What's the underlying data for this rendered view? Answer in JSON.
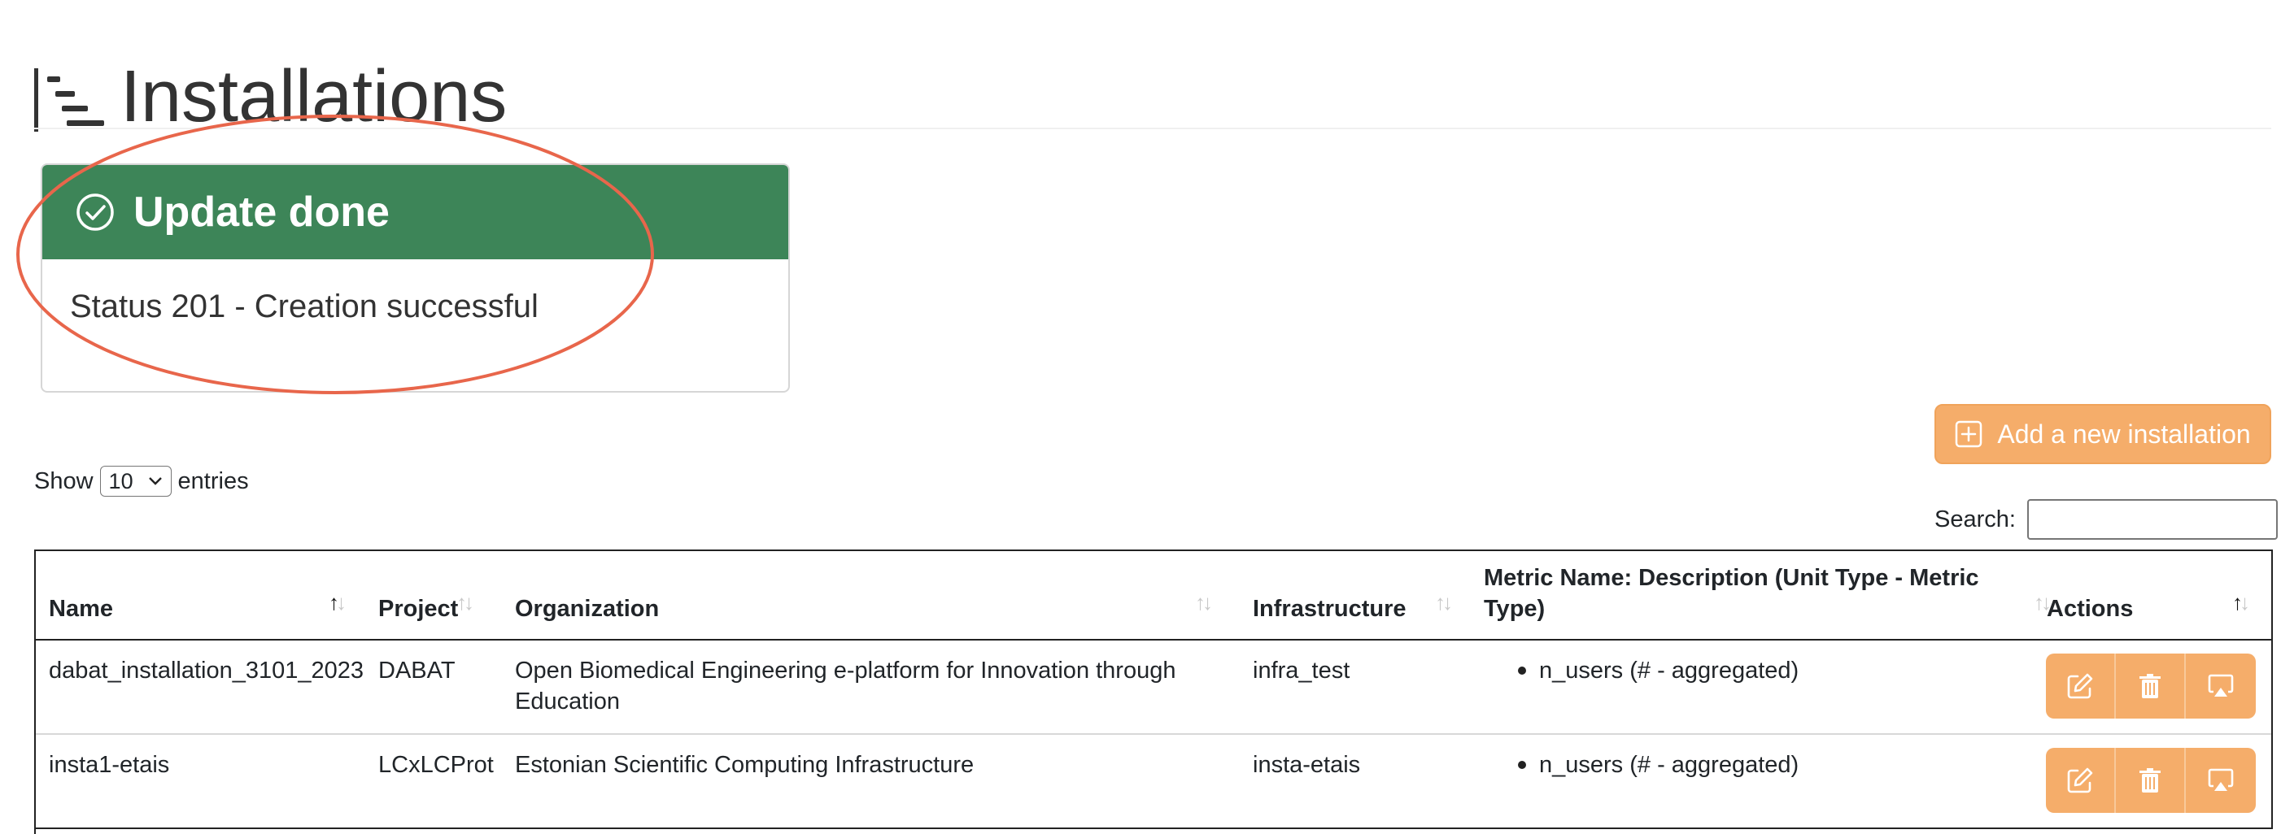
{
  "page": {
    "title": "Installations",
    "icon": "list-tree-icon"
  },
  "alert": {
    "title": "Update done",
    "message": "Status 201 - Creation successful",
    "color": "#3d8558",
    "icon": "check-circle-icon"
  },
  "annotation_color": "#e8664b",
  "add_button": {
    "label": "Add a new installation",
    "icon": "plus-square-icon",
    "color": "#f5ad6a"
  },
  "length_control": {
    "prefix": "Show",
    "selected": "10",
    "suffix": "entries"
  },
  "search": {
    "label": "Search:",
    "value": ""
  },
  "table": {
    "columns": [
      {
        "label": "Name",
        "sort": "asc"
      },
      {
        "label": "Project",
        "sort": "none"
      },
      {
        "label": "Organization",
        "sort": "none"
      },
      {
        "label": "Infrastructure",
        "sort": "none"
      },
      {
        "label": "Metric Name: Description (Unit Type - Metric Type)",
        "sort": "none"
      },
      {
        "label": "Actions",
        "sort": "asc"
      }
    ],
    "rows": [
      {
        "name": "dabat_installation_3101_2023",
        "project": "DABAT",
        "organization": "Open Biomedical Engineering e-platform for Innovation through Education",
        "infrastructure": "infra_test",
        "metric": "n_users (# - aggregated)"
      },
      {
        "name": "insta1-etais",
        "project": "LCxLCProt",
        "organization": "Estonian Scientific Computing Infrastructure",
        "infrastructure": "insta-etais",
        "metric": "n_users (# - aggregated)"
      }
    ],
    "action_icons": [
      "edit-icon",
      "trash-icon",
      "airplay-icon"
    ]
  }
}
